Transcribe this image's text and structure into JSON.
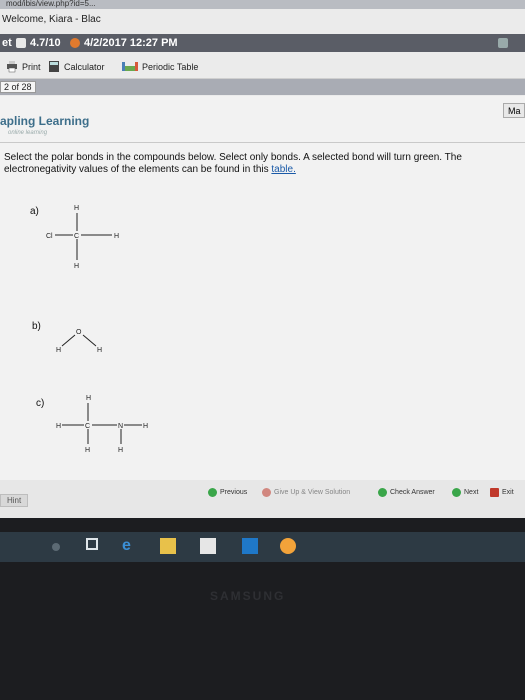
{
  "browser": {
    "url_fragment": "mod/ibis/view.php?id=5..."
  },
  "header": {
    "welcome": "Welcome, Kiara - Blac",
    "date_prefix": "et",
    "date_start": "4.7/10",
    "date_due": "4/2/2017 12:27 PM"
  },
  "toolbar": {
    "print_label": "Print",
    "calculator_label": "Calculator",
    "periodic_label": "Periodic Table"
  },
  "page": {
    "indicator": "2 of 28"
  },
  "brand": {
    "name": "apling Learning",
    "tagline": "online learning",
    "ma_label": "Ma"
  },
  "question": {
    "text": "Select the polar bonds in the compounds below. Select only bonds. A selected bond will turn green. The electronegativity values of the elements can be found in this ",
    "link": "table."
  },
  "molecules": {
    "a": {
      "label": "a)",
      "atoms": {
        "top": "H",
        "left": "Cl",
        "center": "C",
        "right": "H",
        "bottom": "H"
      }
    },
    "b": {
      "label": "b)",
      "atoms": {
        "center": "O",
        "left": "H",
        "right": "H"
      }
    },
    "c": {
      "label": "c)",
      "atoms": {
        "top": "H",
        "left": "H",
        "c": "C",
        "n": "N",
        "right": "H",
        "bottom1": "H",
        "bottom2": "H"
      }
    }
  },
  "footer": {
    "hint": "Hint",
    "previous": "Previous",
    "give_up": "Give Up & View Solution",
    "check": "Check Answer",
    "next": "Next",
    "exit": "Exit"
  },
  "colors": {
    "brand": "#3d6e8a",
    "link": "#1a5aa8",
    "check_green": "#3aa64a",
    "next_green": "#3aa64a",
    "giveup_red": "#c0392b",
    "taskbar": "#2d3a44"
  },
  "device": {
    "brand": "SAMSUNG"
  }
}
